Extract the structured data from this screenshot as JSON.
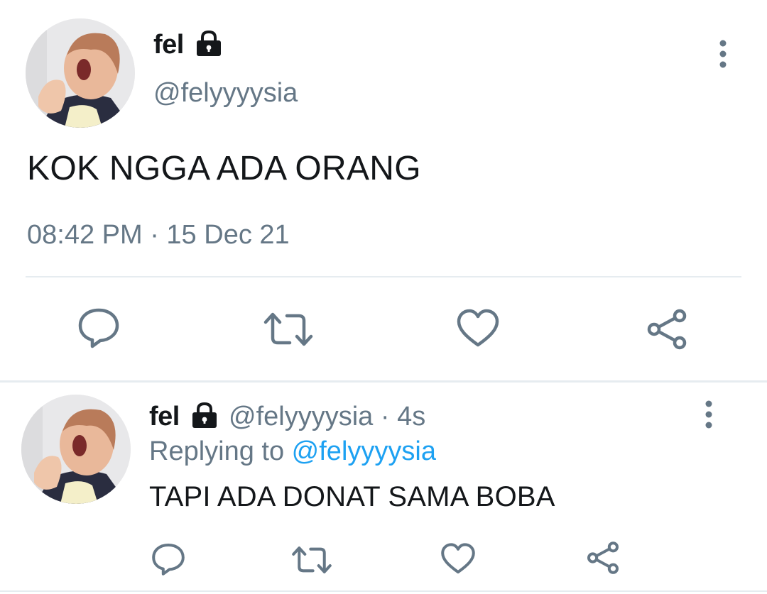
{
  "main_tweet": {
    "author_name": "fel",
    "handle": "@felyyyysia",
    "text": "KOK NGGA ADA ORANG",
    "timestamp": "08:42 PM · 15 Dec 21",
    "icons": {
      "lock": "lock-icon",
      "more": "more-vertical-icon",
      "reply": "comment-icon",
      "retweet": "retweet-icon",
      "like": "heart-icon",
      "share": "share-icon"
    }
  },
  "reply_tweet": {
    "author_name": "fel",
    "handle": "@felyyyysia",
    "separator": " · ",
    "time_ago": "4s",
    "replying_prefix": "Replying to ",
    "replying_to": "@felyyyysia",
    "text": "TAPI ADA DONAT SAMA BOBA"
  },
  "colors": {
    "text_primary": "#14171a",
    "text_secondary": "#657786",
    "mention_blue": "#1da1f2",
    "divider": "#e6ecf0"
  }
}
